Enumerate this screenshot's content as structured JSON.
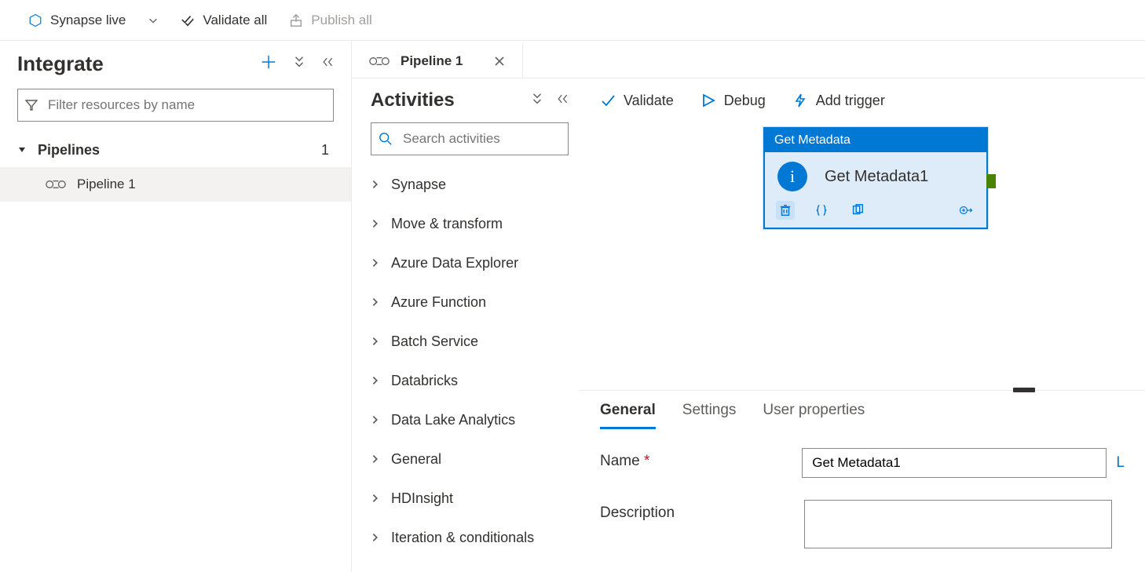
{
  "topbar": {
    "workspace_label": "Synapse live",
    "validate_all": "Validate all",
    "publish_all": "Publish all"
  },
  "left_panel": {
    "title": "Integrate",
    "filter_placeholder": "Filter resources by name",
    "tree": {
      "group_label": "Pipelines",
      "group_count": "1",
      "items": [
        {
          "label": "Pipeline 1"
        }
      ]
    }
  },
  "tabs": [
    {
      "label": "Pipeline 1"
    }
  ],
  "activities_panel": {
    "title": "Activities",
    "search_placeholder": "Search activities",
    "categories": [
      "Synapse",
      "Move & transform",
      "Azure Data Explorer",
      "Azure Function",
      "Batch Service",
      "Databricks",
      "Data Lake Analytics",
      "General",
      "HDInsight",
      "Iteration & conditionals"
    ]
  },
  "canvas_toolbar": {
    "validate": "Validate",
    "debug": "Debug",
    "add_trigger": "Add trigger"
  },
  "activity_card": {
    "type_label": "Get Metadata",
    "instance_name": "Get Metadata1"
  },
  "properties": {
    "tabs": [
      "General",
      "Settings",
      "User properties"
    ],
    "active_tab_index": 0,
    "name_label": "Name",
    "name_value": "Get Metadata1",
    "description_label": "Description",
    "description_value": ""
  },
  "colors": {
    "accent": "#0078d4",
    "selection_bg": "#deecf9",
    "success": "#498205"
  }
}
